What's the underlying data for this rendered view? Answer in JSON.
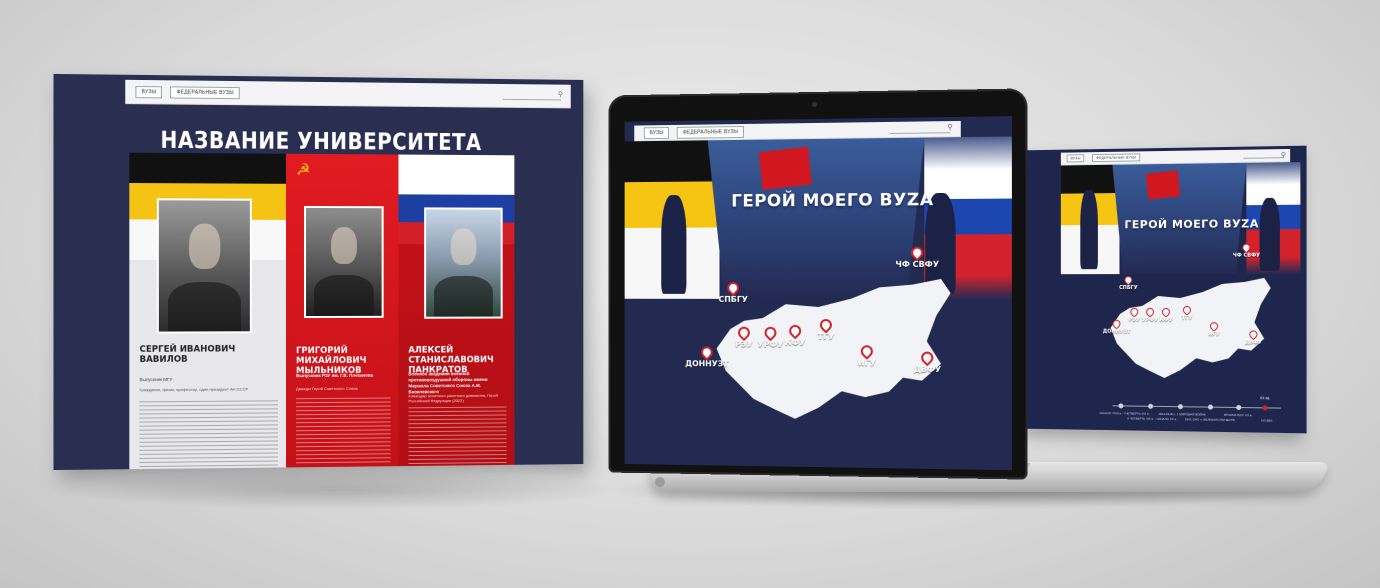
{
  "left_screen": {
    "nav": {
      "btn1": "ВУЗЫ",
      "btn2": "ФЕДЕРАЛЬНЫЕ ВУЗЫ"
    },
    "title": "НАЗВАНИЕ УНИВЕРСИТЕТА",
    "heroes": [
      {
        "name": "СЕРГЕЙ ИВАНОВИЧ ВАВИЛОВ",
        "subtitle": "Выпускник МГУ",
        "note": "Гражданин, физик, профессор, один президент АН СССР"
      },
      {
        "name": "ГРИГОРИЙ МИХАЙЛОВИЧ МЫЛЬНИКОВ",
        "subtitle": "Выпускник РЗУ им. Г.В. Плеханова",
        "note": "Дважды Герой Советского Союза"
      },
      {
        "name": "АЛЕКСЕЙ СТАНИСЛАВОВИЧ ПАНКРАТОВ",
        "subtitle": "Военное академии военной противовоздушной обороны имени Маршала Советского Союза А.М. Василевского",
        "note": "Командир зенитного ракетного дивизиона, Герой Российской Федерации (2022)"
      }
    ]
  },
  "laptop": {
    "nav": {
      "btn1": "ВУЗЫ",
      "btn2": "ФЕДЕРАЛЬНЫЕ ВУЗЫ"
    },
    "title": "ГЕРОЙ МОЕГО ВУZА",
    "pins": [
      {
        "label": "СПБГУ"
      },
      {
        "label": "РЭУ"
      },
      {
        "label": "УРФУ"
      },
      {
        "label": "КФУ"
      },
      {
        "label": "ТГУ"
      },
      {
        "label": "ИГУ"
      },
      {
        "label": "ДОННУЗТ"
      },
      {
        "label": "ДВФУ"
      },
      {
        "label": "ЧФ СВФУ"
      }
    ]
  },
  "right_screen": {
    "nav": {
      "btn1": "ВУЗЫ",
      "btn2": "ФЕДЕРАЛЬНЫЕ ВУЗЫ"
    },
    "title": "ГЕРОЙ МОЕГО ВУZА",
    "pins": [
      {
        "label": "СПБГУ"
      },
      {
        "label": "РЭУ"
      },
      {
        "label": "УРФУ"
      },
      {
        "label": "КФУ"
      },
      {
        "label": "ТГУ"
      },
      {
        "label": "ИГУ"
      },
      {
        "label": "ДОННУЗТ"
      },
      {
        "label": "ДВФУ"
      },
      {
        "label": "ЧФ СВФУ"
      }
    ],
    "timeline": {
      "active_year": "ХХ вв",
      "labels": [
        "НАЧАЛО XVIII в.- I ЧЕТВЕРТЬ XIX в.",
        "II ЧЕТВЕРТЬ XIX в. - НАЧАЛО XX в.",
        "1914-1918 гг. 1 МИРОВАЯ ВОЙНА",
        "1941-1945 гг. ВЕЛИКАЯ ОТЕЧЕСТВ.",
        "ВТОРАЯ ПОЛ. XX в.",
        "XXI ВЕК"
      ]
    }
  }
}
